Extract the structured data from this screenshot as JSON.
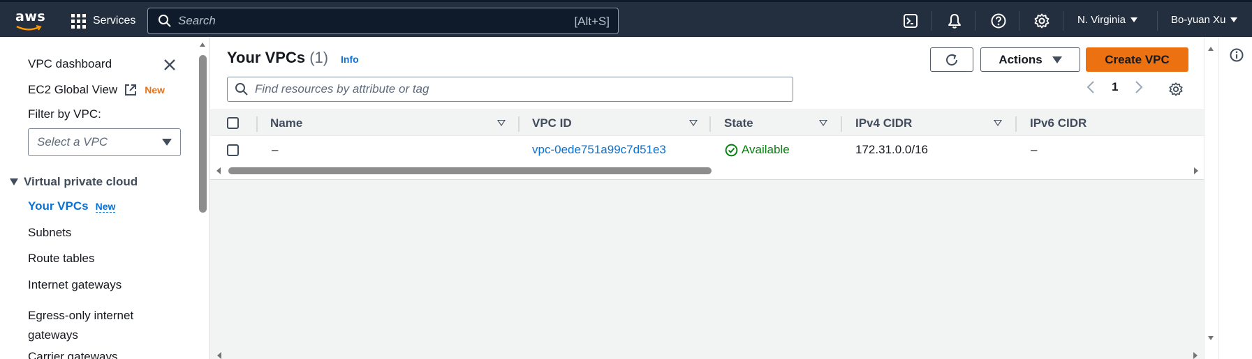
{
  "topnav": {
    "logo_text": "aws",
    "services_label": "Services",
    "search_placeholder": "Search",
    "search_shortcut": "[Alt+S]",
    "region": "N. Virginia",
    "user": "Bo-yuan Xu",
    "icons": [
      "cloudshell-icon",
      "notifications-icon",
      "help-icon",
      "settings-icon"
    ]
  },
  "sidebar": {
    "dashboard": "VPC dashboard",
    "ec2_global_view": "EC2 Global View",
    "ec2_badge": "New",
    "filter_label": "Filter by VPC:",
    "filter_placeholder": "Select a VPC",
    "section": "Virtual private cloud",
    "items": [
      {
        "label": "Your VPCs",
        "badge": "New",
        "active": true
      },
      {
        "label": "Subnets"
      },
      {
        "label": "Route tables"
      },
      {
        "label": "Internet gateways"
      },
      {
        "label": "Egress-only internet gateways"
      },
      {
        "label": "Carrier gateways"
      }
    ]
  },
  "main": {
    "title": "Your VPCs",
    "count": "(1)",
    "info": "Info",
    "actions_label": "Actions",
    "create_label": "Create VPC",
    "filter_placeholder": "Find resources by attribute or tag",
    "page": "1",
    "columns": [
      "Name",
      "VPC ID",
      "State",
      "IPv4 CIDR",
      "IPv6 CIDR"
    ],
    "rows": [
      {
        "name": "–",
        "vpc_id": "vpc-0ede751a99c7d51e3",
        "state": "Available",
        "ipv4": "172.31.0.0/16",
        "ipv6": "–"
      }
    ]
  },
  "colors": {
    "nav_bg": "#232f3e",
    "primary_orange": "#ec7211",
    "link_blue": "#0972d3",
    "status_green": "#037f0c"
  }
}
